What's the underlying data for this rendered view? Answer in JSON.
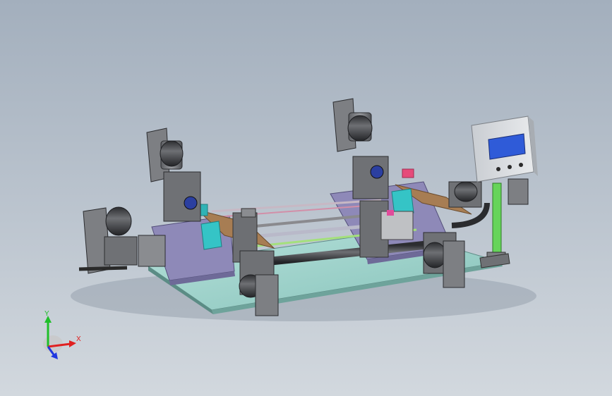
{
  "triad": {
    "x_label": "X",
    "y_label": "Y",
    "x_color": "#e02020",
    "y_color": "#1fbf2a",
    "z_color": "#2038e0"
  },
  "colors": {
    "background_top": "#a3afbd",
    "base_plate": "#9fd3cc",
    "frame_purple": "#8e89b8",
    "motor_gray": "#7d7f83",
    "motor_dark": "#3f4145",
    "rail_brown": "#a77d53",
    "teal_part": "#35c4c6",
    "green_post": "#66d45a",
    "hmi_screen": "#2f5bd8"
  }
}
